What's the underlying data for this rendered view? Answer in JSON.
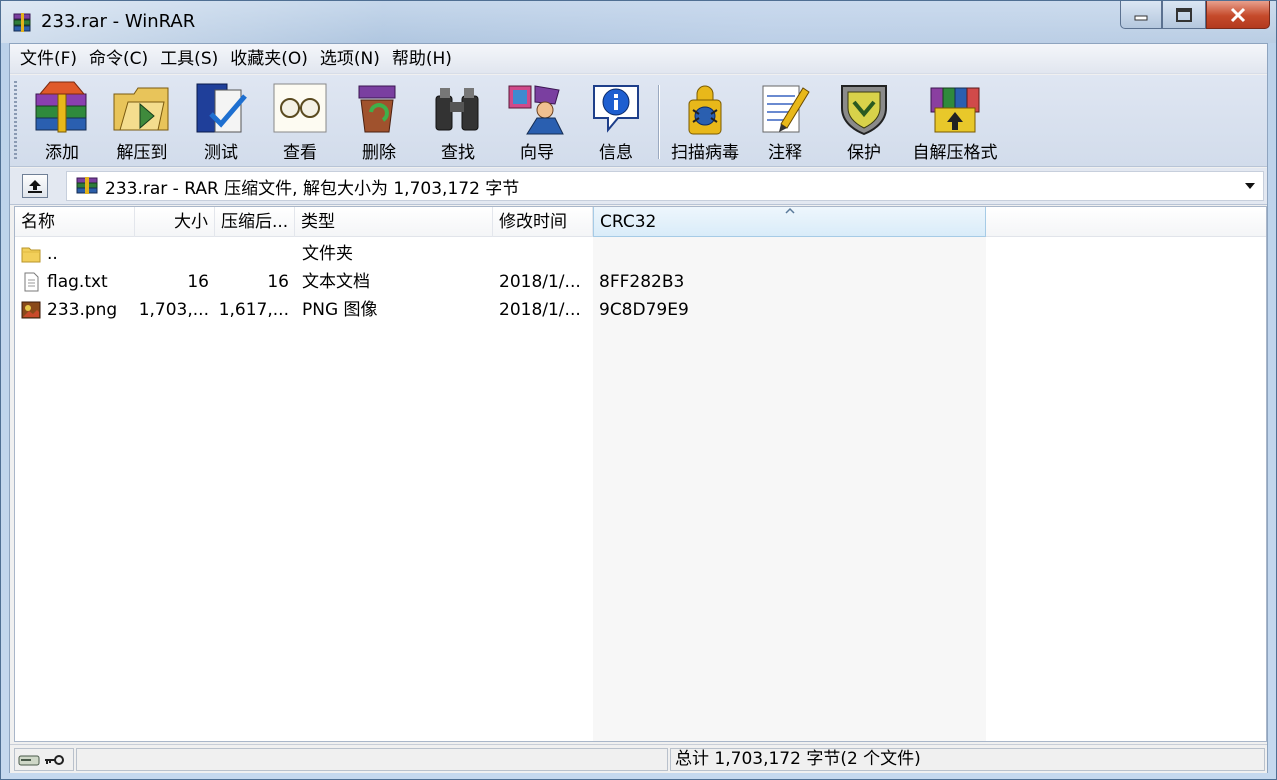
{
  "window": {
    "title": "233.rar - WinRAR"
  },
  "menu": [
    {
      "label": "文件(F)"
    },
    {
      "label": "命令(C)"
    },
    {
      "label": "工具(S)"
    },
    {
      "label": "收藏夹(O)"
    },
    {
      "label": "选项(N)"
    },
    {
      "label": "帮助(H)"
    }
  ],
  "toolbar": {
    "add": "添加",
    "extract": "解压到",
    "test": "测试",
    "view": "查看",
    "delete": "删除",
    "find": "查找",
    "wizard": "向导",
    "info": "信息",
    "virusscan": "扫描病毒",
    "comment": "注释",
    "protect": "保护",
    "sfx": "自解压格式"
  },
  "address": {
    "text": "233.rar - RAR 压缩文件, 解包大小为 1,703,172 字节"
  },
  "columns": {
    "name": "名称",
    "size": "大小",
    "packed": "压缩后...",
    "type": "类型",
    "modified": "修改时间",
    "crc": "CRC32"
  },
  "files": [
    {
      "name": "..",
      "size": "",
      "packed": "",
      "type": "文件夹",
      "modified": "",
      "crc": "",
      "icon": "folder-icon"
    },
    {
      "name": "flag.txt",
      "size": "16",
      "packed": "16",
      "type": "文本文档",
      "modified": "2018/1/...",
      "crc": "8FF282B3",
      "icon": "text-file-icon"
    },
    {
      "name": "233.png",
      "size": "1,703,...",
      "packed": "1,617,...",
      "type": "PNG 图像",
      "modified": "2018/1/...",
      "crc": "9C8D79E9",
      "icon": "image-file-icon"
    }
  ],
  "status": {
    "total": "总计 1,703,172 字节(2 个文件)"
  },
  "colors": {
    "frame": "#a9c4e2",
    "close_button": "#c54a2b",
    "sorted_header": "#d9ecf9"
  }
}
